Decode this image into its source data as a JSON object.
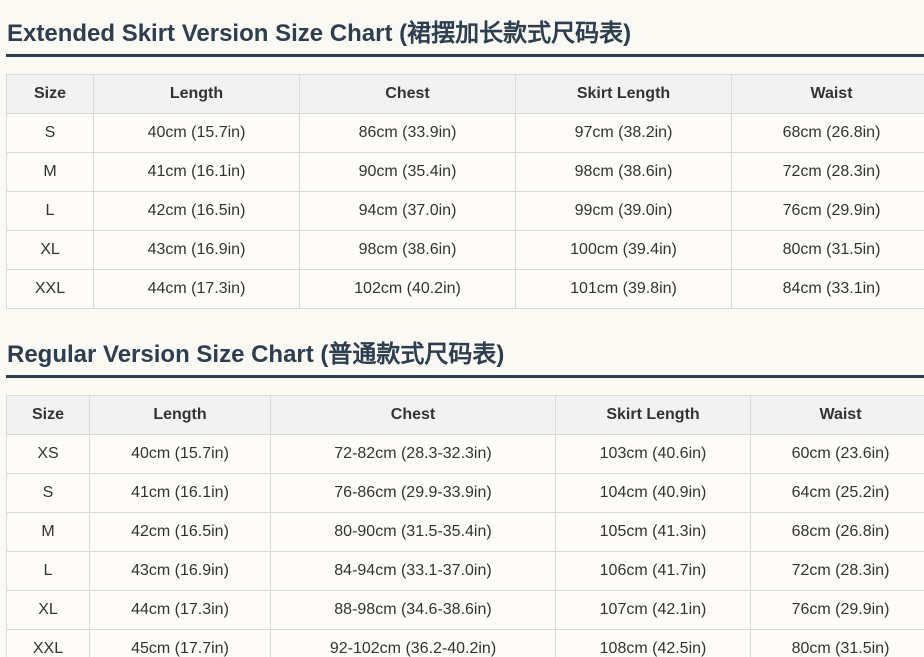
{
  "tables": [
    {
      "title": "Extended Skirt Version Size Chart (裙摆加长款式尺码表)",
      "headers": [
        "Size",
        "Length",
        "Chest",
        "Skirt Length",
        "Waist"
      ],
      "rows": [
        [
          "S",
          "40cm (15.7in)",
          "86cm (33.9in)",
          "97cm (38.2in)",
          "68cm (26.8in)"
        ],
        [
          "M",
          "41cm (16.1in)",
          "90cm (35.4in)",
          "98cm (38.6in)",
          "72cm (28.3in)"
        ],
        [
          "L",
          "42cm (16.5in)",
          "94cm (37.0in)",
          "99cm (39.0in)",
          "76cm (29.9in)"
        ],
        [
          "XL",
          "43cm (16.9in)",
          "98cm (38.6in)",
          "100cm (39.4in)",
          "80cm (31.5in)"
        ],
        [
          "XXL",
          "44cm (17.3in)",
          "102cm (40.2in)",
          "101cm (39.8in)",
          "84cm (33.1in)"
        ]
      ]
    },
    {
      "title": "Regular Version Size Chart (普通款式尺码表)",
      "headers": [
        "Size",
        "Length",
        "Chest",
        "Skirt Length",
        "Waist"
      ],
      "rows": [
        [
          "XS",
          "40cm (15.7in)",
          "72-82cm (28.3-32.3in)",
          "103cm (40.6in)",
          "60cm (23.6in)"
        ],
        [
          "S",
          "41cm (16.1in)",
          "76-86cm (29.9-33.9in)",
          "104cm (40.9in)",
          "64cm (25.2in)"
        ],
        [
          "M",
          "42cm (16.5in)",
          "80-90cm (31.5-35.4in)",
          "105cm (41.3in)",
          "68cm (26.8in)"
        ],
        [
          "L",
          "43cm (16.9in)",
          "84-94cm (33.1-37.0in)",
          "106cm (41.7in)",
          "72cm (28.3in)"
        ],
        [
          "XL",
          "44cm (17.3in)",
          "88-98cm (34.6-38.6in)",
          "107cm (42.1in)",
          "76cm (29.9in)"
        ],
        [
          "XXL",
          "45cm (17.7in)",
          "92-102cm (36.2-40.2in)",
          "108cm (42.5in)",
          "80cm (31.5in)"
        ]
      ]
    }
  ]
}
